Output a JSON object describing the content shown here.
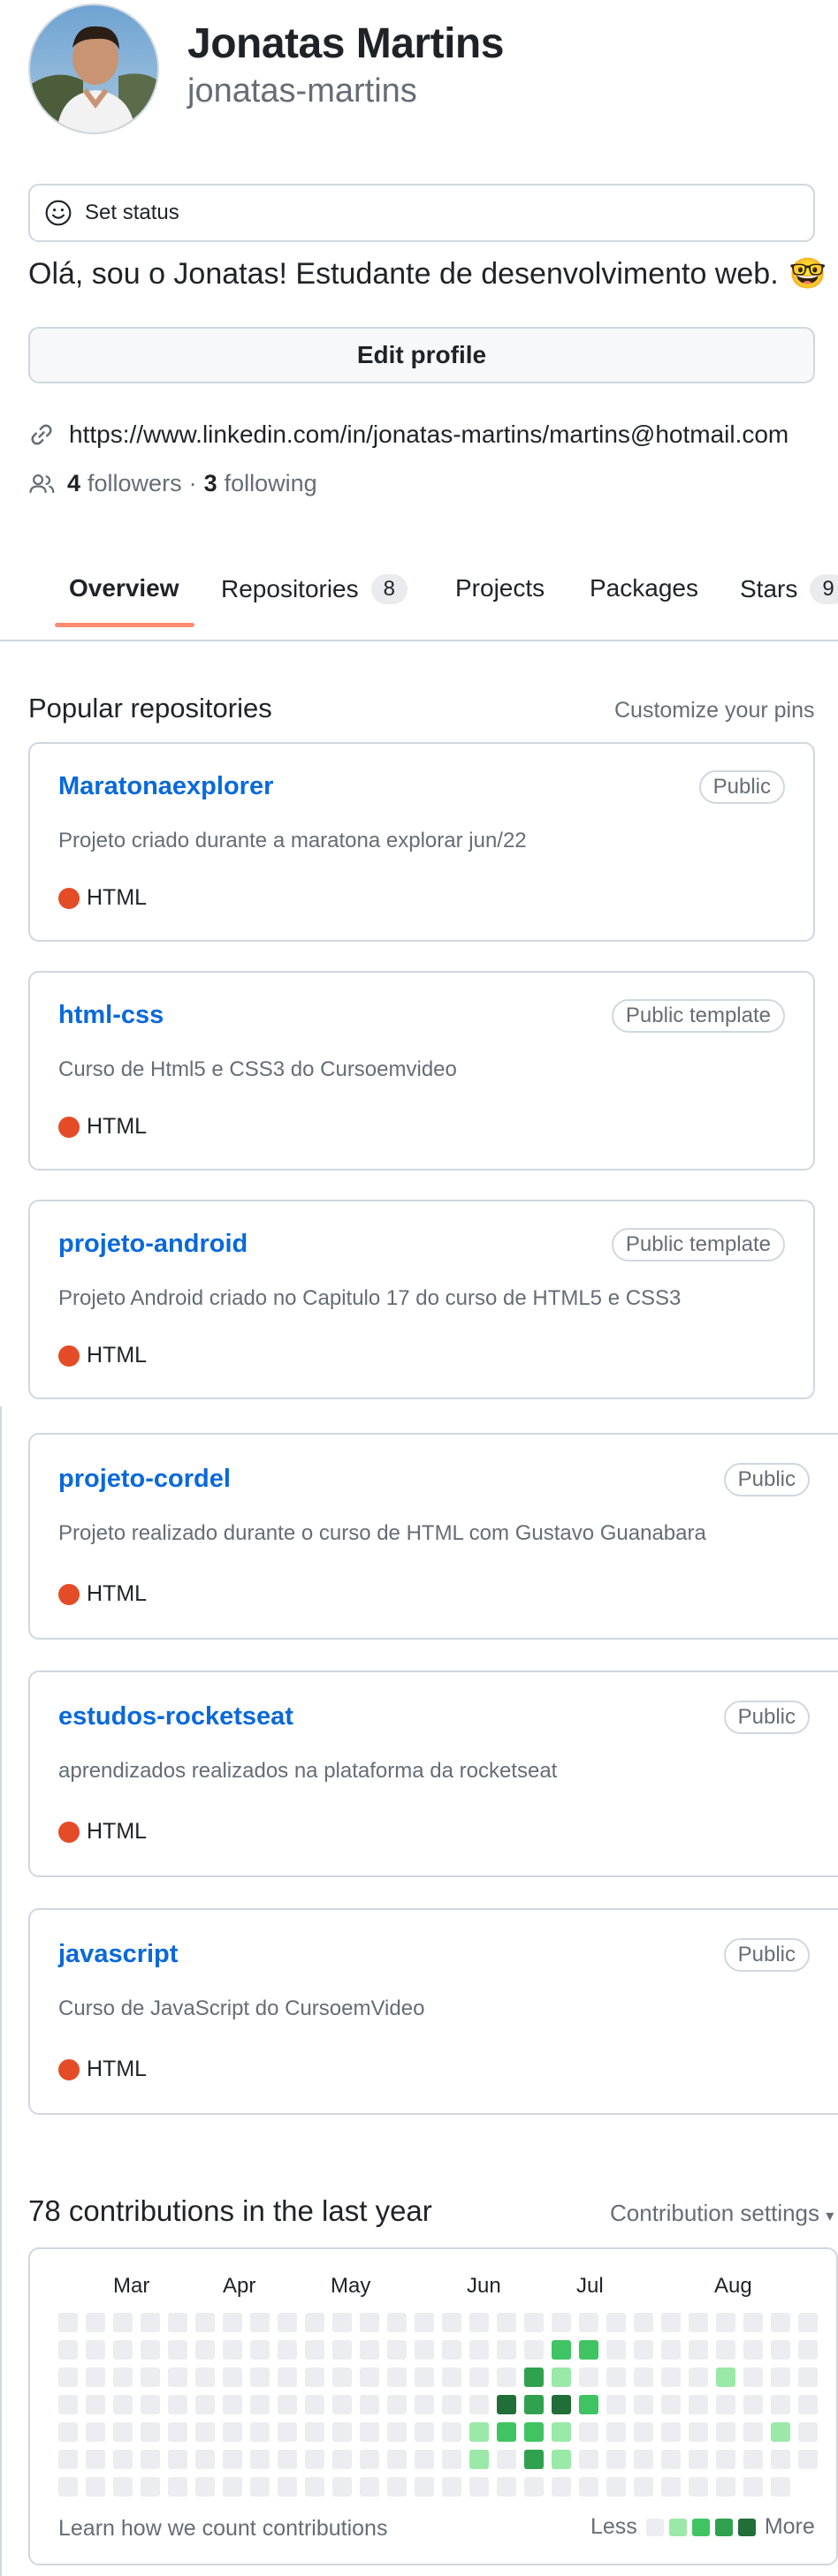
{
  "profile": {
    "name": "Jonatas Martins",
    "username": "jonatas-martins",
    "status_label": "Set status",
    "bio": "Olá, sou o Jonatas! Estudante de desenvolvimento web.",
    "bio_emoji": "🤓",
    "edit_label": "Edit profile",
    "link": "https://www.linkedin.com/in/jonatas-martins/martins@hotmail.com",
    "followers_count": "4",
    "followers_label": "followers",
    "separator": "·",
    "following_count": "3",
    "following_label": "following"
  },
  "tabs": [
    {
      "label": "Overview",
      "counter": "",
      "active": true
    },
    {
      "label": "Repositories",
      "counter": "8"
    },
    {
      "label": "Projects",
      "counter": ""
    },
    {
      "label": "Packages",
      "counter": ""
    },
    {
      "label": "Stars",
      "counter": "9"
    }
  ],
  "popular": {
    "title": "Popular repositories",
    "customize_label": "Customize your pins",
    "repos": [
      {
        "name": "Maratonaexplorer",
        "badge": "Public",
        "description": "Projeto criado durante a maratona explorar jun/22",
        "language": "HTML",
        "lang_color": "#e34c26"
      },
      {
        "name": "html-css",
        "badge": "Public template",
        "description": "Curso de Html5 e CSS3 do Cursoemvideo",
        "language": "HTML",
        "lang_color": "#e34c26"
      },
      {
        "name": "projeto-android",
        "badge": "Public template",
        "description": "Projeto Android criado no Capitulo 17 do curso de HTML5 e CSS3",
        "language": "HTML",
        "lang_color": "#e34c26"
      },
      {
        "name": "projeto-cordel",
        "badge": "Public",
        "description": "Projeto realizado durante o curso de HTML com Gustavo Guanabara",
        "language": "HTML",
        "lang_color": "#e34c26"
      },
      {
        "name": "estudos-rocketseat",
        "badge": "Public",
        "description": "aprendizados realizados na plataforma da rocketseat",
        "language": "HTML",
        "lang_color": "#e34c26"
      },
      {
        "name": "javascript",
        "badge": "Public",
        "description": "Curso de JavaScript do CursoemVideo",
        "language": "HTML",
        "lang_color": "#e34c26"
      }
    ]
  },
  "contributions": {
    "title": "78 contributions in the last year",
    "settings_label": "Contribution settings",
    "months": [
      "Mar",
      "Apr",
      "May",
      "Jun",
      "Jul",
      "Aug"
    ],
    "learn_label": "Learn how we count contributions",
    "legend_less": "Less",
    "legend_more": "More",
    "colors": [
      "#ebedf0",
      "#9be9a8",
      "#40c463",
      "#30a14e",
      "#216e39"
    ],
    "levels": [
      [
        0,
        0,
        0,
        0,
        0,
        0,
        0,
        0,
        0,
        0,
        0,
        0,
        0,
        0,
        0,
        0,
        0,
        0,
        0,
        0,
        0,
        0,
        0,
        0,
        0,
        0,
        0,
        0
      ],
      [
        0,
        0,
        0,
        0,
        0,
        0,
        0,
        0,
        0,
        0,
        0,
        0,
        0,
        0,
        0,
        0,
        0,
        0,
        2,
        2,
        0,
        0,
        0,
        0,
        0,
        0,
        0,
        0
      ],
      [
        0,
        0,
        0,
        0,
        0,
        0,
        0,
        0,
        0,
        0,
        0,
        0,
        0,
        0,
        0,
        0,
        0,
        3,
        1,
        0,
        0,
        0,
        0,
        0,
        1,
        0,
        0,
        0
      ],
      [
        0,
        0,
        0,
        0,
        0,
        0,
        0,
        0,
        0,
        0,
        0,
        0,
        0,
        0,
        0,
        0,
        4,
        3,
        4,
        2,
        0,
        0,
        0,
        0,
        0,
        0,
        0,
        0
      ],
      [
        0,
        0,
        0,
        0,
        0,
        0,
        0,
        0,
        0,
        0,
        0,
        0,
        0,
        0,
        0,
        1,
        2,
        2,
        1,
        0,
        0,
        0,
        0,
        0,
        0,
        0,
        1,
        0
      ],
      [
        0,
        0,
        0,
        0,
        0,
        0,
        0,
        0,
        0,
        0,
        0,
        0,
        0,
        0,
        0,
        1,
        0,
        3,
        1,
        0,
        0,
        0,
        0,
        0,
        0,
        0,
        0,
        0
      ],
      [
        0,
        0,
        0,
        0,
        0,
        0,
        0,
        0,
        0,
        0,
        0,
        0,
        0,
        0,
        0,
        0,
        0,
        0,
        0,
        0,
        0,
        0,
        0,
        0,
        0,
        0,
        0,
        0
      ]
    ]
  }
}
